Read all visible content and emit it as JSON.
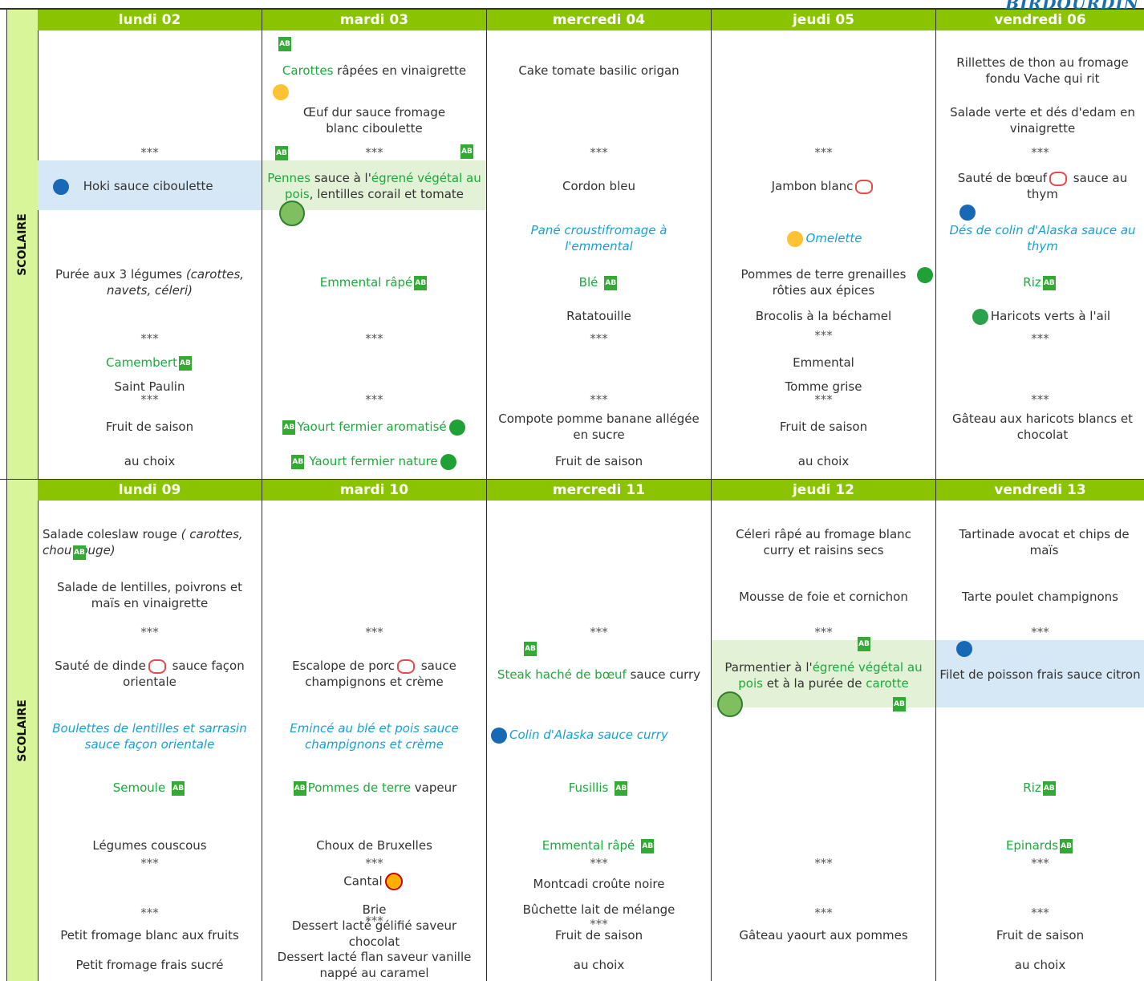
{
  "brand": "BIRDOURDIN",
  "side_label": "SCOLAIRE",
  "week1": {
    "days": [
      {
        "header": "lundi 02",
        "entree": [
          "",
          "",
          "",
          ""
        ],
        "sep1": "***",
        "plat": "Hoki sauce ciboulette",
        "alt": "",
        "acc1a": "Purée aux 3 légumes ",
        "acc1b": "(carottes, navets, céleri)",
        "acc2": "",
        "sep2": "***",
        "cheese1": "Camembert",
        "cheese2": "Saint Paulin",
        "sep3": "***",
        "dessert1": "Fruit de saison",
        "dessert2": "au choix"
      },
      {
        "header": "mardi 03",
        "entree1a": "Carottes",
        "entree1b": " râpées en vinaigrette",
        "entree2": "Œuf dur sauce fromage blanc ciboulette",
        "sep1": "***",
        "plat_a": "Pennes",
        "plat_b": " sauce à l'",
        "plat_c": "égrené végétal au pois",
        "plat_d": ", lentilles corail et tomate",
        "acc1": "Emmental râpé",
        "sep2": "***",
        "sep3": "***",
        "dessert1": "Yaourt fermier aromatisé",
        "dessert2": "Yaourt fermier nature"
      },
      {
        "header": "mercredi 04",
        "entree": "Cake tomate basilic origan",
        "sep1": "***",
        "plat": "Cordon bleu",
        "alt": "Pané croustifromage à l'emmental",
        "acc1": "Blé",
        "acc2": "Ratatouille",
        "sep2": "***",
        "sep3": "***",
        "dessert1": "Compote pomme banane allégée en sucre",
        "dessert2": "Fruit de saison"
      },
      {
        "header": "jeudi 05",
        "sep1": "***",
        "plat": "Jambon blanc",
        "alt": "Omelette",
        "acc1": "Pommes de terre grenailles rôties aux épices",
        "acc2": "Brocolis à la béchamel",
        "sep2": "***",
        "cheese1": "Emmental",
        "cheese2": "Tomme grise",
        "sep3": "***",
        "dessert1": "Fruit de saison",
        "dessert2": "au choix"
      },
      {
        "header": "vendredi 06",
        "entree1": "Rillettes de thon au fromage fondu Vache qui rit",
        "entree2": "Salade verte et dés d'edam en vinaigrette",
        "sep1": "***",
        "plat_a": "Sauté de bœuf",
        "plat_b": " sauce au thym",
        "alt": "Dés de colin d'Alaska sauce au thym",
        "acc1": "Riz",
        "acc2": "Haricots verts à l'ail",
        "sep2": "***",
        "sep3": "***",
        "dessert1": "Gâteau aux haricots blancs et chocolat"
      }
    ]
  },
  "week2": {
    "days": [
      {
        "header": "lundi 09",
        "entree1a": "Salade coleslaw rouge ",
        "entree1b": "( carottes, chou rouge)",
        "entree2": "Salade de lentilles, poivrons et maïs en vinaigrette",
        "sep1": "***",
        "plat_a": "Sauté de dinde",
        "plat_b": " sauce façon orientale",
        "alt": "Boulettes de lentilles et sarrasin sauce façon orientale",
        "acc1": "Semoule",
        "acc2": "Légumes couscous",
        "sep2": "***",
        "sep3": "***",
        "dessert1": "Petit fromage blanc aux fruits",
        "dessert2": "Petit fromage frais sucré"
      },
      {
        "header": "mardi 10",
        "sep1": "***",
        "plat_a": "Escalope de porc",
        "plat_b": " sauce champignons et crème",
        "alt": "Emincé au blé et pois sauce champignons et crème",
        "acc1a": "Pommes de terre",
        "acc1b": " vapeur",
        "acc2": "Choux de Bruxelles",
        "sep2": "***",
        "cheese1": "Cantal",
        "cheese2": "Brie",
        "sep3": "***",
        "dessert1": "Dessert lacté gélifié saveur chocolat",
        "dessert2": "Dessert lacté flan saveur vanille nappé au caramel"
      },
      {
        "header": "mercredi 11",
        "sep1": "***",
        "plat_a": "Steak haché de bœuf",
        "plat_b": " sauce curry",
        "alt": "Colin d'Alaska sauce curry",
        "acc1": "Fusillis",
        "acc2": "Emmental râpé",
        "sep2": "***",
        "cheese1": "Montcadi croûte noire",
        "cheese2": "Bûchette lait de mélange",
        "sep3": "***",
        "dessert1": "Fruit de saison",
        "dessert2": "au choix"
      },
      {
        "header": "jeudi 12",
        "entree1": "Céleri râpé au fromage blanc curry et raisins secs",
        "entree2": "Mousse de foie et cornichon",
        "sep1": "***",
        "plat_a": "Parmentier à l'",
        "plat_b": "égrené végétal au pois",
        "plat_c": " et à la purée de ",
        "plat_d": "carotte",
        "sep2": "***",
        "sep3": "***",
        "dessert1": "Gâteau yaourt aux pommes"
      },
      {
        "header": "vendredi 13",
        "entree1": "Tartinade avocat et chips de maïs",
        "entree2": "Tarte poulet champignons",
        "sep1": "***",
        "plat": "Filet de poisson frais sauce citron",
        "acc1": "Riz",
        "acc2": "Epinards",
        "sep2": "***",
        "sep3": "***",
        "dessert1": "Fruit de saison",
        "dessert2": "au choix"
      }
    ]
  },
  "ab_text": "AB"
}
